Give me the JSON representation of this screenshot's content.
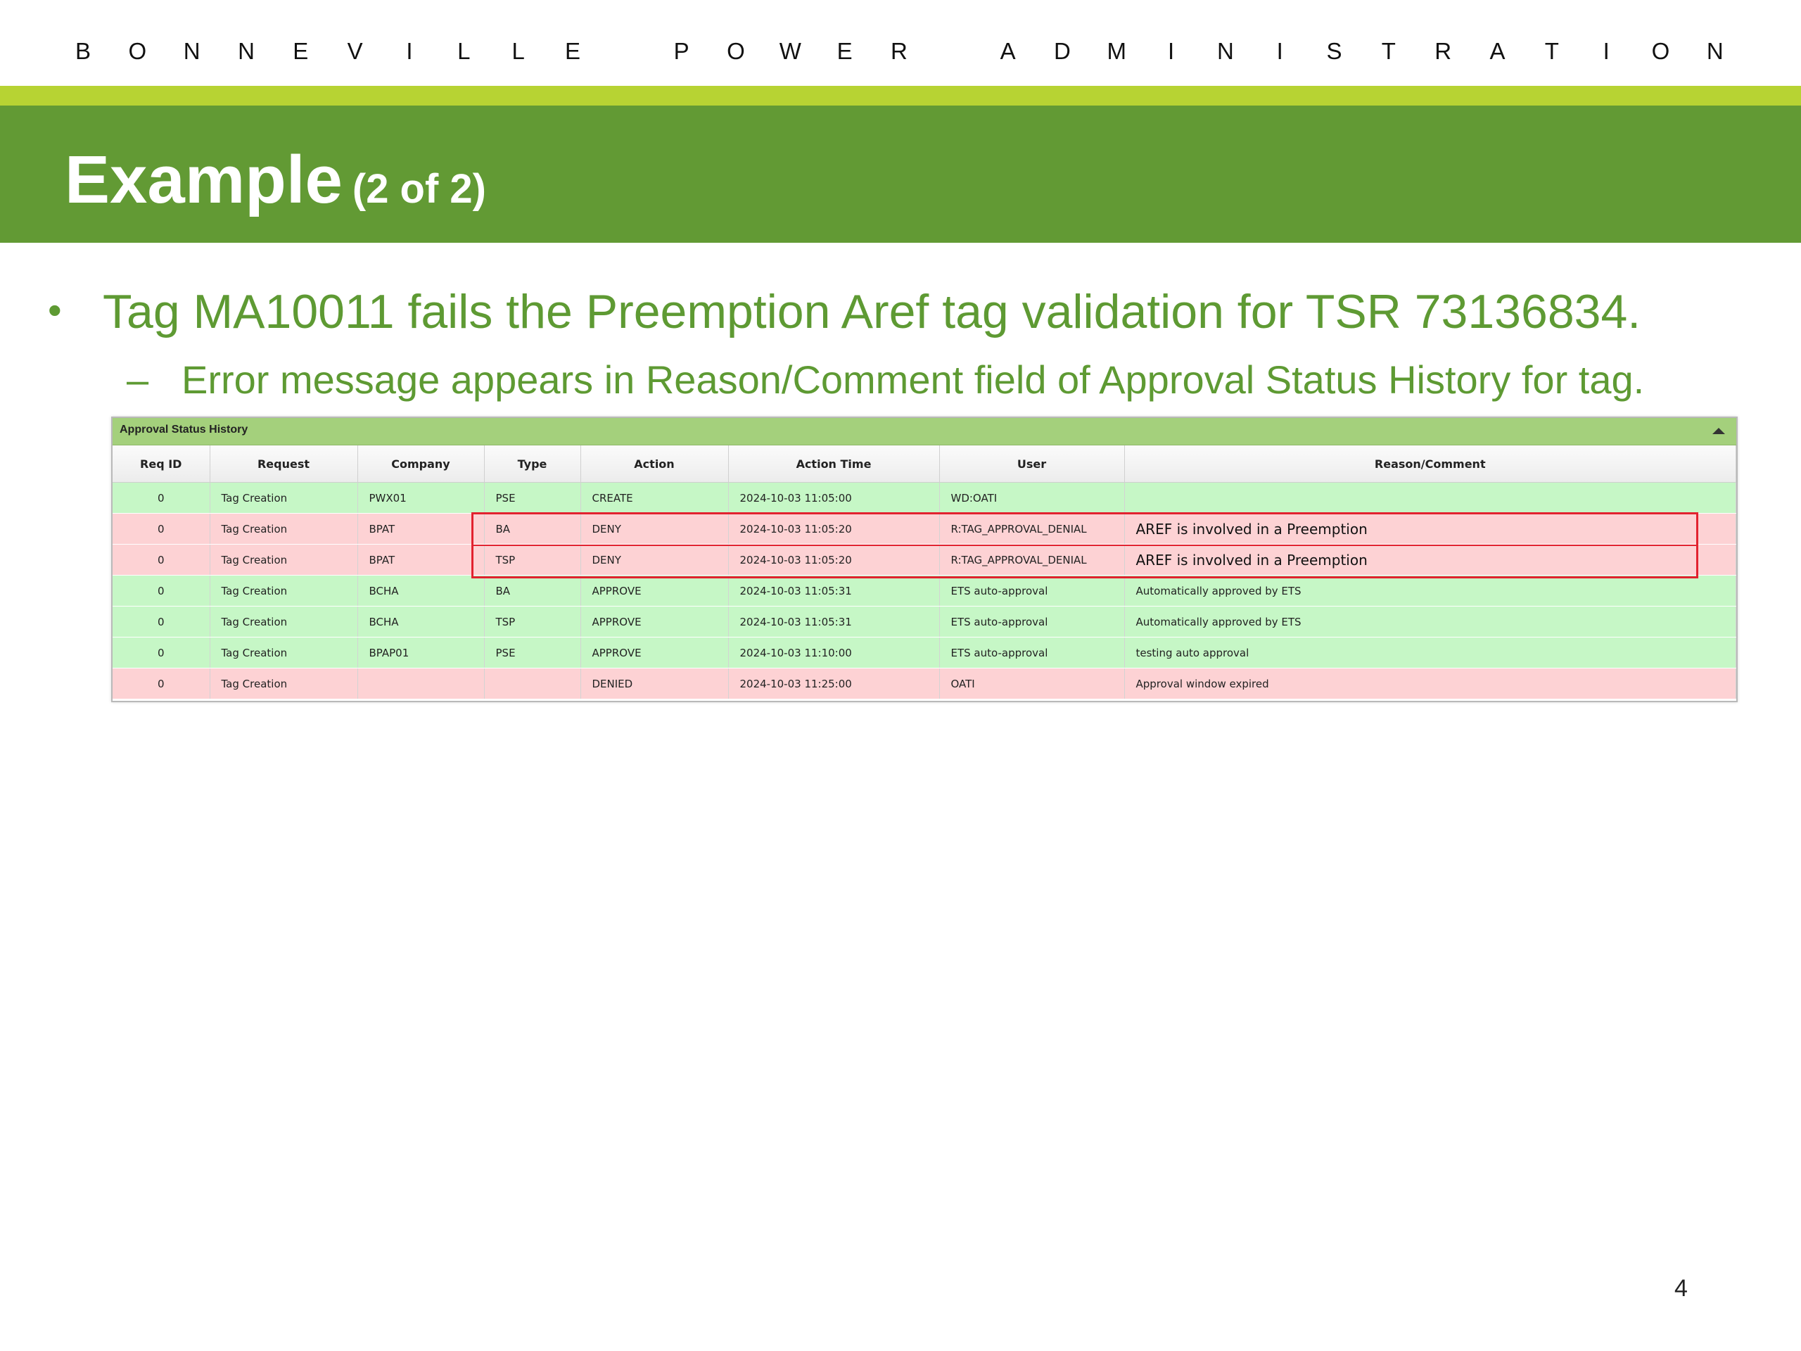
{
  "header": {
    "org_letters": [
      "B",
      "O",
      "N",
      "N",
      "E",
      "V",
      "I",
      "L",
      "L",
      "E",
      "",
      "P",
      "O",
      "W",
      "E",
      "R",
      "",
      "A",
      "D",
      "M",
      "I",
      "N",
      "I",
      "S",
      "T",
      "R",
      "A",
      "T",
      "I",
      "O",
      "N"
    ]
  },
  "slide": {
    "title": "Example",
    "title_suffix": "(2 of 2)",
    "bullet_1": "Tag MA10011 fails the Preemption Aref tag validation for TSR 73136834.",
    "bullet_2": "Error message appears in Reason/Comment field of Approval Status History for tag.",
    "page_number": "4",
    "bullet_dot": "•",
    "sub_dash": "–"
  },
  "panel": {
    "title": "Approval Status History",
    "columns": [
      "Req ID",
      "Request",
      "Company",
      "Type",
      "Action",
      "Action Time",
      "User",
      "Reason/Comment"
    ],
    "rows": [
      {
        "status": "ok",
        "cells": [
          "0",
          "Tag Creation",
          "PWX01",
          "PSE",
          "CREATE",
          "2024-10-03 11:05:00",
          "WD:OATI",
          ""
        ]
      },
      {
        "status": "bad",
        "cells": [
          "0",
          "Tag Creation",
          "BPAT",
          "BA",
          "DENY",
          "2024-10-03 11:05:20",
          "R:TAG_APPROVAL_DENIAL",
          "AREF is involved in a Preemption"
        ]
      },
      {
        "status": "bad",
        "cells": [
          "0",
          "Tag Creation",
          "BPAT",
          "TSP",
          "DENY",
          "2024-10-03 11:05:20",
          "R:TAG_APPROVAL_DENIAL",
          "AREF is involved in a Preemption"
        ]
      },
      {
        "status": "ok",
        "cells": [
          "0",
          "Tag Creation",
          "BCHA",
          "BA",
          "APPROVE",
          "2024-10-03 11:05:31",
          "ETS auto-approval",
          "Automatically approved by ETS"
        ]
      },
      {
        "status": "ok",
        "cells": [
          "0",
          "Tag Creation",
          "BCHA",
          "TSP",
          "APPROVE",
          "2024-10-03 11:05:31",
          "ETS auto-approval",
          "Automatically approved by ETS"
        ]
      },
      {
        "status": "ok",
        "cells": [
          "0",
          "Tag Creation",
          "BPAP01",
          "PSE",
          "APPROVE",
          "2024-10-03 11:10:00",
          "ETS auto-approval",
          "testing auto approval"
        ]
      },
      {
        "status": "bad",
        "cells": [
          "0",
          "Tag Creation",
          "",
          "",
          "DENIED",
          "2024-10-03 11:25:00",
          "OATI",
          "Approval window expired"
        ]
      }
    ],
    "colors": {
      "approved_row": "#c6f7c6",
      "denied_row": "#fdd2d4",
      "highlight": "#e2222f",
      "band": "#629a34",
      "accent": "#b7d333"
    }
  }
}
